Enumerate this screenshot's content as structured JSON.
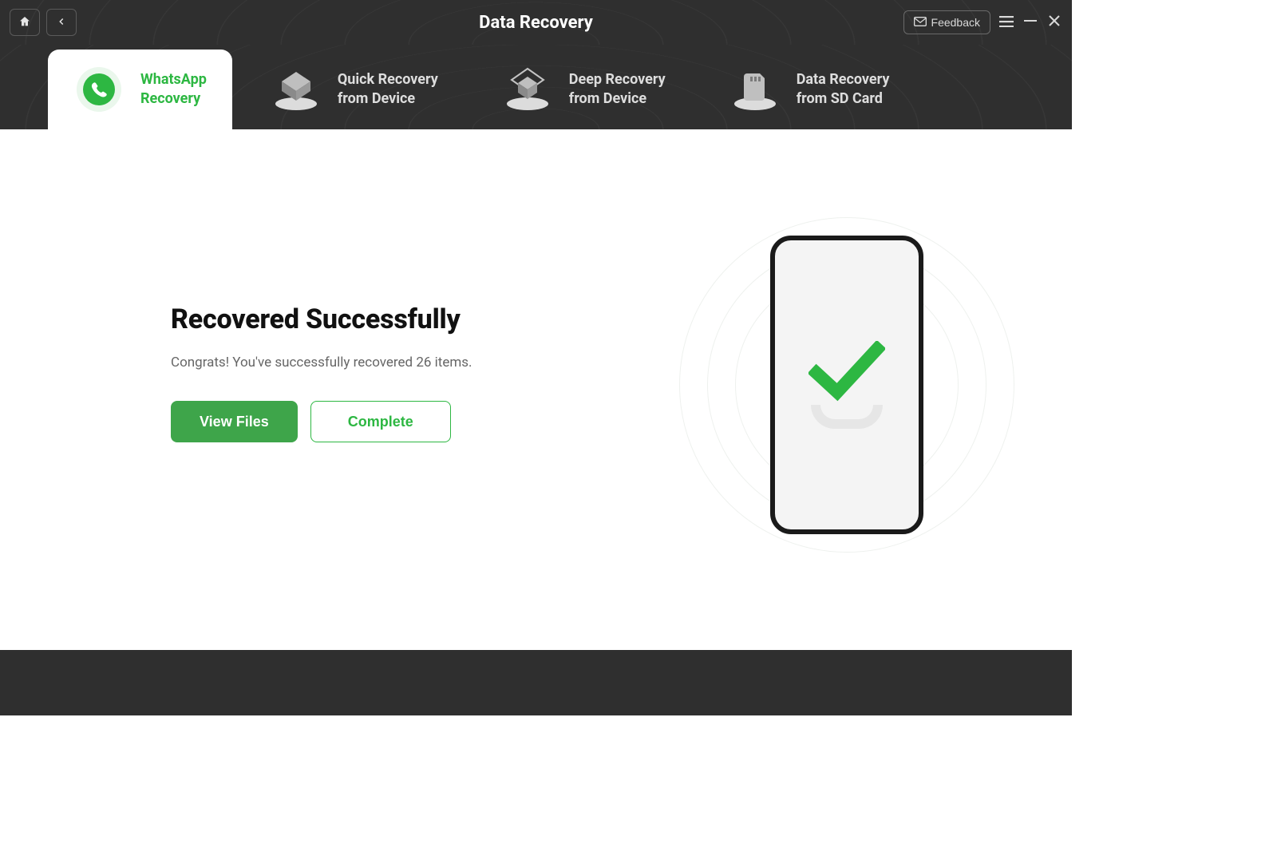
{
  "header": {
    "title": "Data Recovery",
    "feedback_label": "Feedback"
  },
  "tabs": [
    {
      "label": "WhatsApp\nRecovery",
      "active": true
    },
    {
      "label": "Quick Recovery\nfrom Device",
      "active": false
    },
    {
      "label": "Deep Recovery\nfrom Device",
      "active": false
    },
    {
      "label": "Data Recovery\nfrom SD Card",
      "active": false
    }
  ],
  "main": {
    "heading": "Recovered Successfully",
    "subtext": "Congrats! You've successfully recovered 26 items.",
    "view_files_label": "View Files",
    "complete_label": "Complete"
  }
}
